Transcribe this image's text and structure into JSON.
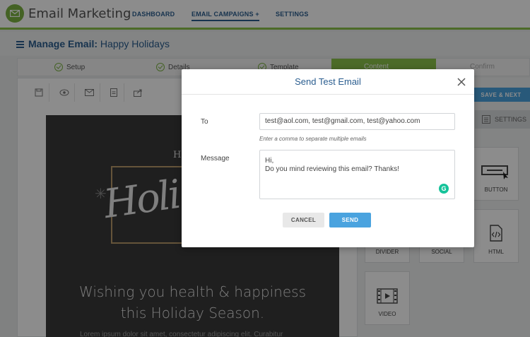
{
  "app": {
    "title": "Email Marketing",
    "accent_color": "#8bc34a",
    "brand_color": "#2a5d8f"
  },
  "nav": {
    "dashboard": "DASHBOARD",
    "campaigns": "EMAIL CAMPAIGNS +",
    "settings": "SETTINGS"
  },
  "page": {
    "title_prefix": "Manage Email:",
    "title_name": "Happy Holidays"
  },
  "steps": [
    {
      "label": "Setup"
    },
    {
      "label": "Details"
    },
    {
      "label": "Template"
    },
    {
      "label": "Content"
    },
    {
      "label": "Confirm"
    }
  ],
  "editor": {
    "save_next": "SAVE & NEXT",
    "settings_tab": "SETTINGS",
    "blocks": {
      "button": "BUTTON",
      "divider": "DIVIDER",
      "social": "SOCIAL",
      "html": "HTML",
      "video": "VIDEO"
    }
  },
  "preview": {
    "top_text": "H",
    "script_text": "Holi",
    "headline_1": "Wishing you health & happiness",
    "headline_2": "this Holiday Season.",
    "body_fragment": "Lorem ipsum dolor sit amet, consectetur adipiscing elit. Curabitur"
  },
  "modal": {
    "title": "Send Test Email",
    "to_label": "To",
    "to_value": "test@aol.com, test@gmail.com, test@yahoo.com",
    "to_hint": "Enter a comma to separate multiple emails",
    "message_label": "Message",
    "message_line1": "Hi,",
    "message_line2": "Do you mind reviewing this email? Thanks!",
    "cancel": "CANCEL",
    "send": "SEND"
  }
}
